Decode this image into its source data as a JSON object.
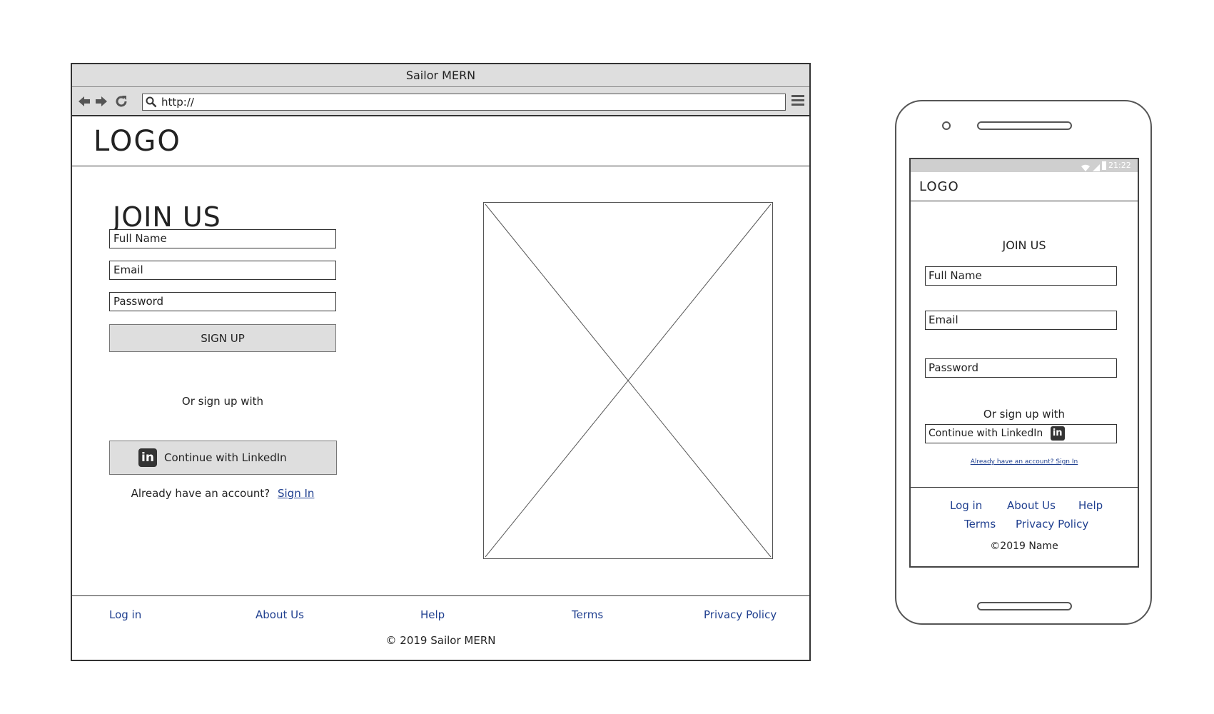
{
  "browser": {
    "title": "Sailor MERN",
    "url": "http://",
    "logo": "LOGO",
    "form": {
      "heading": "JOIN US",
      "full_name_placeholder": "Full Name",
      "email_placeholder": "Email",
      "password_placeholder": "Password",
      "signup_label": "SIGN UP",
      "or_text": "Or sign up with",
      "linkedin_label": "Continue with LinkedIn",
      "linkedin_badge": "in",
      "account_text": "Already have an account?",
      "signin_link": "Sign In"
    },
    "footer": {
      "links": [
        "Log in",
        "About Us",
        "Help",
        "Terms",
        "Privacy Policy"
      ],
      "copyright": "© 2019 Sailor MERN"
    }
  },
  "mobile": {
    "status_time": "21:22",
    "logo": "LOGO",
    "form": {
      "heading": "JOIN US",
      "full_name_placeholder": "Full Name",
      "email_placeholder": "Email",
      "password_placeholder": "Password",
      "or_text": "Or sign up with",
      "linkedin_label": "Continue with LinkedIn",
      "linkedin_badge": "in",
      "account_link": "Already have an account? Sign In"
    },
    "footer": {
      "links": [
        "Log in",
        "About Us",
        "Help",
        "Terms",
        "Privacy Policy"
      ],
      "copyright": "©2019 Name"
    }
  },
  "colors": {
    "link": "#1f3f8f",
    "chrome_gray": "#dedede",
    "button_gray": "#dedede"
  }
}
